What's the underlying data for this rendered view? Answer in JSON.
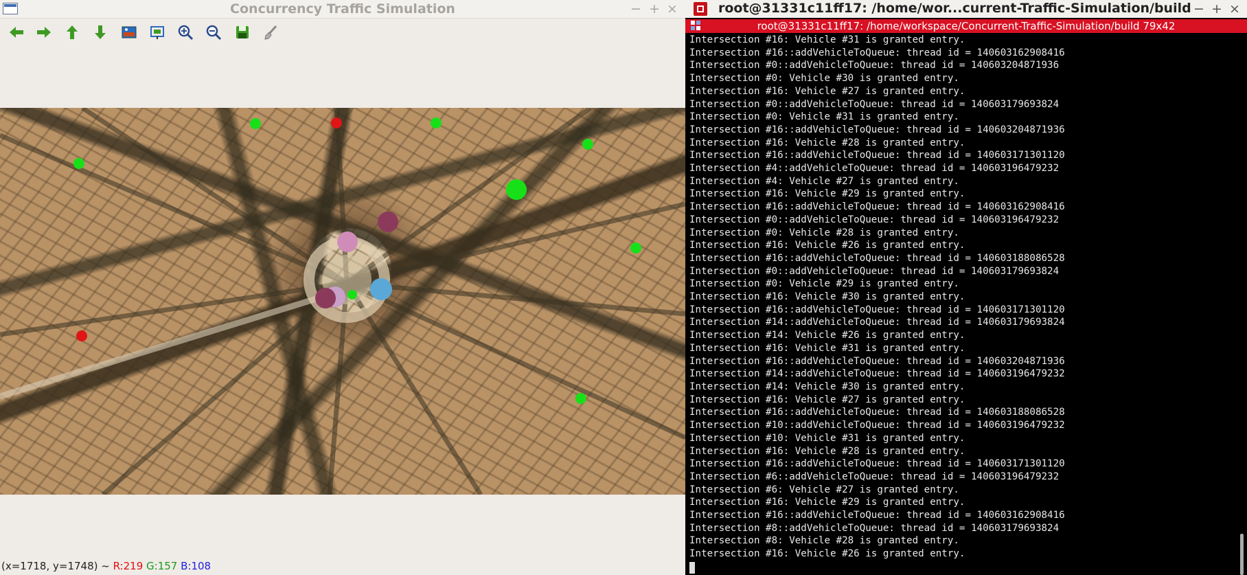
{
  "sim": {
    "title": "Concurrency Traffic Simulation",
    "window_buttons": [
      "−",
      "+",
      "×"
    ],
    "toolbar": [
      {
        "icon": "arrow-left-icon",
        "label": "Pan left"
      },
      {
        "icon": "arrow-right-icon",
        "label": "Pan right"
      },
      {
        "icon": "arrow-up-icon",
        "label": "Pan up"
      },
      {
        "icon": "arrow-down-icon",
        "label": "Pan down"
      },
      {
        "icon": "image-icon",
        "label": "Zoom image"
      },
      {
        "icon": "zoom-region-icon",
        "label": "Zoom region"
      },
      {
        "icon": "zoom-in-icon",
        "label": "Zoom in"
      },
      {
        "icon": "zoom-out-icon",
        "label": "Zoom out"
      },
      {
        "icon": "save-icon",
        "label": "Save"
      },
      {
        "icon": "brush-icon",
        "label": "Properties"
      }
    ],
    "status": {
      "coords": "(x=1718, y=1748) ~ ",
      "r": "R:219",
      "g": "G:157",
      "b": "B:108"
    },
    "colors": {
      "traffic_green": "#18e018",
      "traffic_red": "#e01515",
      "vehicle_pink": "#d08cb8",
      "vehicle_maroon": "#8c3a5c",
      "vehicle_blue": "#5aa8d8",
      "vehicle_lavender": "#c8a0c8"
    }
  },
  "terminal": {
    "outer_title": "root@31331c11ff17: /home/wor...current-Traffic-Simulation/build",
    "outer_buttons": [
      "−",
      "+",
      "×"
    ],
    "inner_title": "root@31331c11ff17: /home/workspace/Concurrent-Traffic-Simulation/build 79x42",
    "lines": [
      "Intersection #16: Vehicle #31 is granted entry.",
      "Intersection #16::addVehicleToQueue: thread id = 140603162908416",
      "Intersection #0::addVehicleToQueue: thread id = 140603204871936",
      "Intersection #0: Vehicle #30 is granted entry.",
      "Intersection #16: Vehicle #27 is granted entry.",
      "Intersection #0::addVehicleToQueue: thread id = 140603179693824",
      "Intersection #0: Vehicle #31 is granted entry.",
      "Intersection #16::addVehicleToQueue: thread id = 140603204871936",
      "Intersection #16: Vehicle #28 is granted entry.",
      "Intersection #16::addVehicleToQueue: thread id = 140603171301120",
      "Intersection #4::addVehicleToQueue: thread id = 140603196479232",
      "Intersection #4: Vehicle #27 is granted entry.",
      "Intersection #16: Vehicle #29 is granted entry.",
      "Intersection #16::addVehicleToQueue: thread id = 140603162908416",
      "Intersection #0::addVehicleToQueue: thread id = 140603196479232",
      "Intersection #0: Vehicle #28 is granted entry.",
      "Intersection #16: Vehicle #26 is granted entry.",
      "Intersection #16::addVehicleToQueue: thread id = 140603188086528",
      "Intersection #0::addVehicleToQueue: thread id = 140603179693824",
      "Intersection #0: Vehicle #29 is granted entry.",
      "Intersection #16: Vehicle #30 is granted entry.",
      "Intersection #16::addVehicleToQueue: thread id = 140603171301120",
      "Intersection #14::addVehicleToQueue: thread id = 140603179693824",
      "Intersection #14: Vehicle #26 is granted entry.",
      "Intersection #16: Vehicle #31 is granted entry.",
      "Intersection #16::addVehicleToQueue: thread id = 140603204871936",
      "Intersection #14::addVehicleToQueue: thread id = 140603196479232",
      "Intersection #14: Vehicle #30 is granted entry.",
      "Intersection #16: Vehicle #27 is granted entry.",
      "Intersection #16::addVehicleToQueue: thread id = 140603188086528",
      "Intersection #10::addVehicleToQueue: thread id = 140603196479232",
      "Intersection #10: Vehicle #31 is granted entry.",
      "Intersection #16: Vehicle #28 is granted entry.",
      "Intersection #16::addVehicleToQueue: thread id = 140603171301120",
      "Intersection #6::addVehicleToQueue: thread id = 140603196479232",
      "Intersection #6: Vehicle #27 is granted entry.",
      "Intersection #16: Vehicle #29 is granted entry.",
      "Intersection #16::addVehicleToQueue: thread id = 140603162908416",
      "Intersection #8::addVehicleToQueue: thread id = 140603179693824",
      "Intersection #8: Vehicle #28 is granted entry.",
      "Intersection #16: Vehicle #26 is granted entry."
    ]
  }
}
